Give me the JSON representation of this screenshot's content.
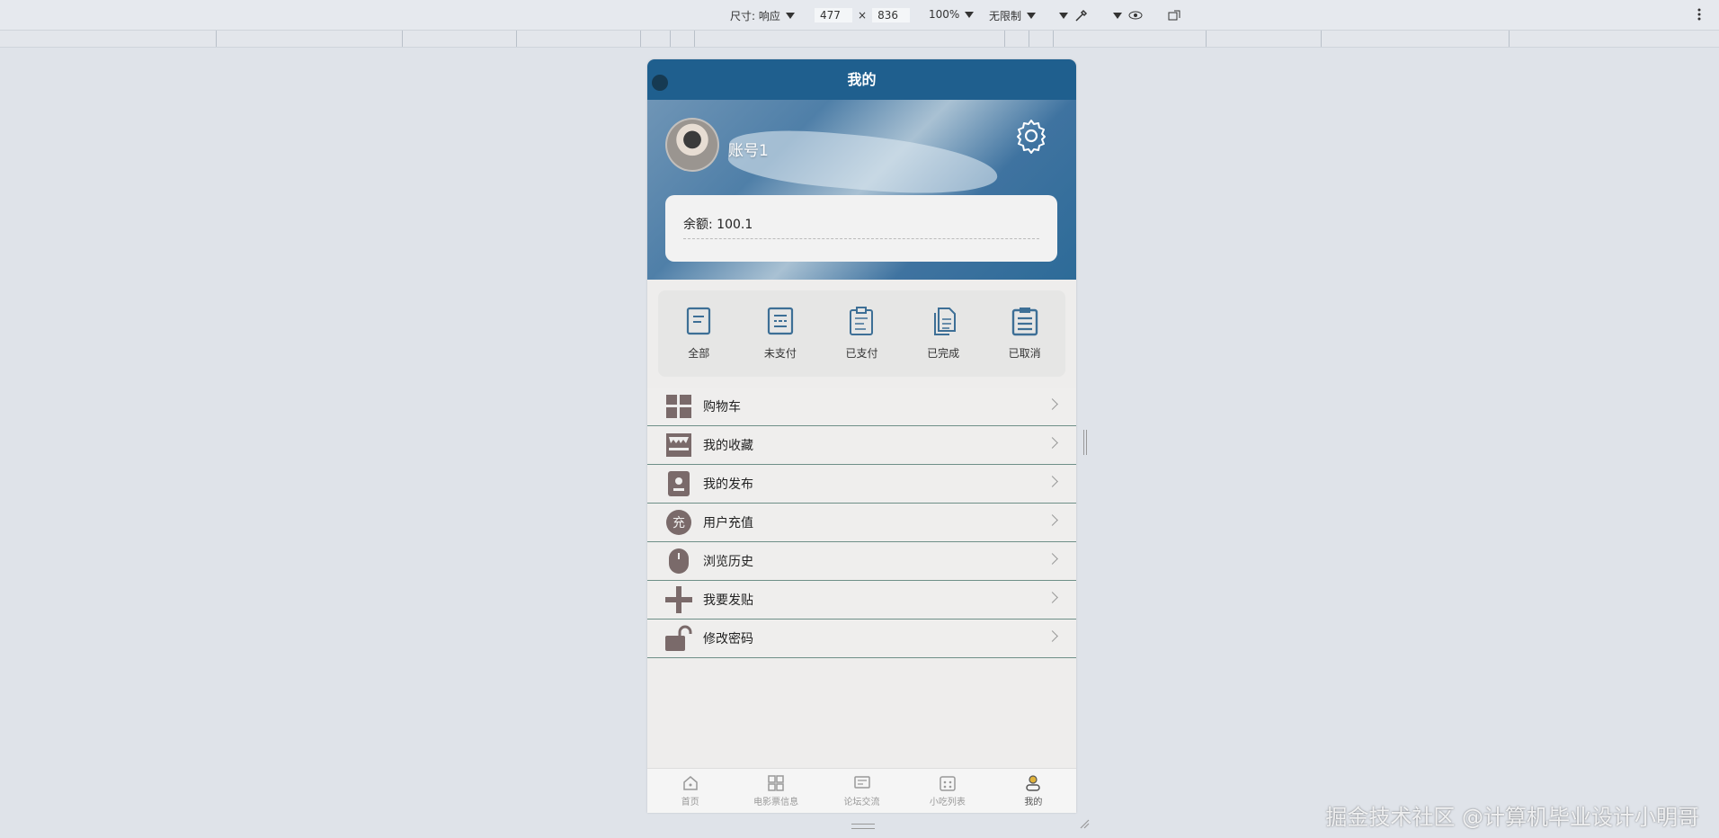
{
  "devtools": {
    "size_label": "尺寸: 响应",
    "width": "477",
    "times": "×",
    "height": "836",
    "zoom": "100%",
    "throttle": "无限制"
  },
  "page": {
    "title": "我的",
    "account_name": "账号1",
    "balance_label": "余额:",
    "balance_value": "100.1"
  },
  "orders": [
    {
      "label": "全部",
      "icon": "doc-icon"
    },
    {
      "label": "未支付",
      "icon": "list-icon"
    },
    {
      "label": "已支付",
      "icon": "clipboard-icon"
    },
    {
      "label": "已完成",
      "icon": "files-icon"
    },
    {
      "label": "已取消",
      "icon": "clipboard-list-icon"
    }
  ],
  "menu": [
    {
      "label": "购物车",
      "icon": "grid-icon"
    },
    {
      "label": "我的收藏",
      "icon": "store-icon"
    },
    {
      "label": "我的发布",
      "icon": "publish-icon"
    },
    {
      "label": "用户充值",
      "icon": "charge-icon",
      "glyph": "充"
    },
    {
      "label": "浏览历史",
      "icon": "mouse-icon"
    },
    {
      "label": "我要发贴",
      "icon": "plus-icon"
    },
    {
      "label": "修改密码",
      "icon": "unlock-icon"
    }
  ],
  "tabs": [
    {
      "label": "首页",
      "icon": "home-icon"
    },
    {
      "label": "电影票信息",
      "icon": "apps-icon"
    },
    {
      "label": "论坛交流",
      "icon": "message-icon"
    },
    {
      "label": "小吃列表",
      "icon": "calendar-icon"
    },
    {
      "label": "我的",
      "icon": "user-icon"
    }
  ],
  "watermark": "掘金技术社区 @计算机毕业设计小明哥",
  "colors": {
    "nav_bg": "#1f5f8e",
    "accent_icon": "#3d6f96",
    "menu_icon": "#7a6a6a",
    "divider": "#6e8f88"
  }
}
